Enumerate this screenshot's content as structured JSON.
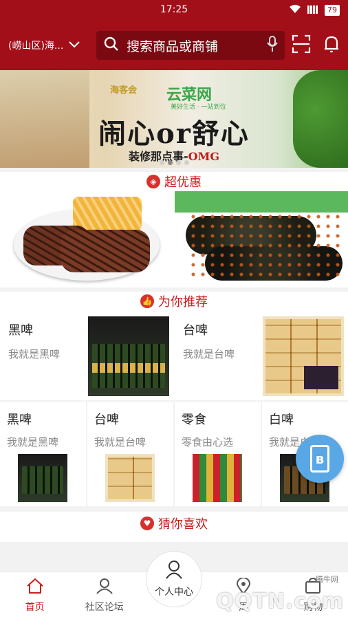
{
  "status": {
    "time": "17:25",
    "battery": "79"
  },
  "header": {
    "location": "(崂山区)海...",
    "search_placeholder": "搜索商品或商铺"
  },
  "banner": {
    "brand1": "海客会",
    "brand2": "云菜网",
    "brand2_slogan": "美好生活 · 一站到位",
    "headline": "闹心or舒心",
    "sub_prefix": "装修那点事-",
    "sub_suffix": "OMG"
  },
  "sections": {
    "deals_title": "超优惠",
    "recommend_title": "为你推荐",
    "guess_title": "猜你喜欢"
  },
  "recommend_top": [
    {
      "title": "黑啤",
      "subtitle": "我就是黑啤"
    },
    {
      "title": "台啤",
      "subtitle": "我就是台啤"
    }
  ],
  "recommend_grid": [
    {
      "title": "黑啤",
      "subtitle": "我就是黑啤"
    },
    {
      "title": "台啤",
      "subtitle": "我就是台啤"
    },
    {
      "title": "零食",
      "subtitle": "零食由心选"
    },
    {
      "title": "白啤",
      "subtitle": "我就是白"
    }
  ],
  "tabs": {
    "home": "首页",
    "forum": "社区论坛",
    "center": "个人中心",
    "t4": "周",
    "t5": "购物"
  },
  "watermark": {
    "big": "QQTN.com",
    "small": "腾牛网"
  },
  "colors": {
    "brand_red": "#a30f19",
    "accent_red": "#c81e1e"
  }
}
